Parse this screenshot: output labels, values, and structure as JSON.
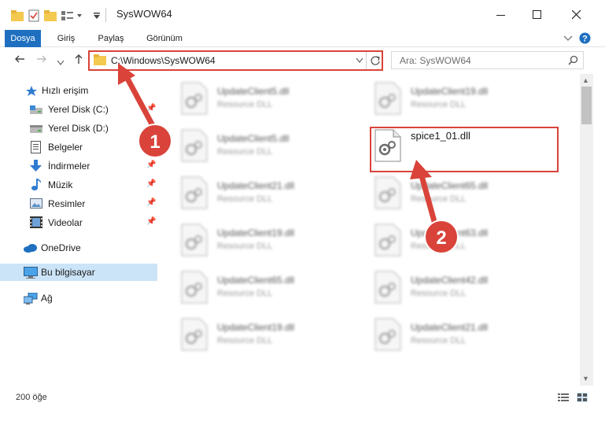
{
  "window": {
    "title": "SysWOW64",
    "minimize_icon": "minimize-icon",
    "maximize_icon": "maximize-icon",
    "close_icon": "close-icon"
  },
  "ribbon": {
    "tabs": [
      {
        "label": "Dosya"
      },
      {
        "label": "Giriş"
      },
      {
        "label": "Paylaş"
      },
      {
        "label": "Görünüm"
      }
    ]
  },
  "address": {
    "path": "C:\\Windows\\SysWOW64"
  },
  "search": {
    "placeholder": "Ara: SysWOW64"
  },
  "sidebar": {
    "items": [
      {
        "label": "Hızlı erişim",
        "icon": "star-icon"
      },
      {
        "label": "Yerel Disk (C:)",
        "icon": "drive-icon"
      },
      {
        "label": "Yerel Disk (D:)",
        "icon": "drive-icon"
      },
      {
        "label": "Belgeler",
        "icon": "document-icon"
      },
      {
        "label": "İndirmeler",
        "icon": "download-icon"
      },
      {
        "label": "Müzik",
        "icon": "music-icon"
      },
      {
        "label": "Resimler",
        "icon": "picture-icon"
      },
      {
        "label": "Videolar",
        "icon": "video-icon"
      },
      {
        "label": "OneDrive",
        "icon": "cloud-icon"
      },
      {
        "label": "Bu bilgisayar",
        "icon": "computer-icon"
      },
      {
        "label": "Ağ",
        "icon": "network-icon"
      }
    ]
  },
  "files": [
    {
      "name": "UpdateClient5.dll",
      "type": "Resource DLL"
    },
    {
      "name": "UpdateClient19.dll",
      "type": "Resource DLL"
    },
    {
      "name": "UpdateClient5.dll",
      "type": "Resource DLL"
    },
    {
      "name": "spice1_01.dll",
      "type": ""
    },
    {
      "name": "UpdateClient21.dll",
      "type": "Resource DLL"
    },
    {
      "name": "UpdateClient65.dll",
      "type": "Resource DLL"
    },
    {
      "name": "UpdateClient19.dll",
      "type": "Resource DLL"
    },
    {
      "name": "UpdateClient63.dll",
      "type": "Resource DLL"
    },
    {
      "name": "UpdateClient65.dll",
      "type": "Resource DLL"
    },
    {
      "name": "UpdateClient42.dll",
      "type": "Resource DLL"
    },
    {
      "name": "UpdateClient19.dll",
      "type": "Resource DLL"
    },
    {
      "name": "UpdateClient21.dll",
      "type": "Resource DLL"
    }
  ],
  "status": {
    "item_count": "200 öğe"
  },
  "annotations": {
    "step1": "1",
    "step2": "2",
    "color": "#d9433a"
  }
}
